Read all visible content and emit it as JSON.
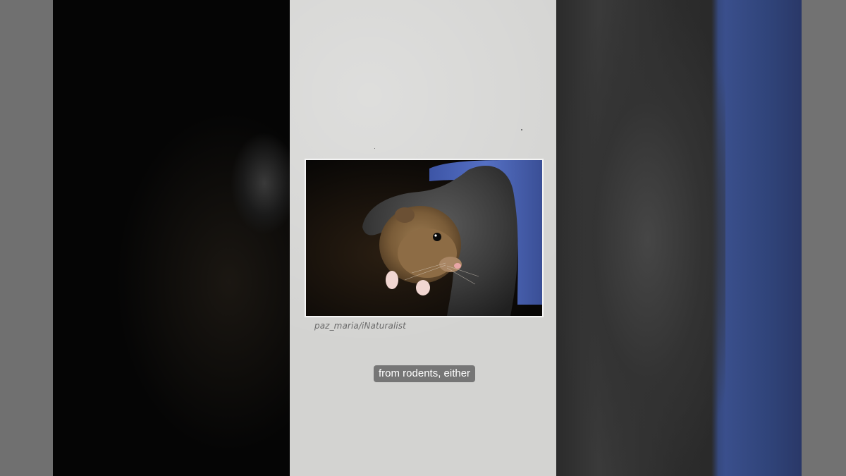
{
  "video": {
    "image_credit": "paz_maria/iNaturalist",
    "caption": "from rodents, either",
    "photo_subject": "mouse-on-glove-image"
  },
  "colors": {
    "paper": "#d3d3d1",
    "caption_bg": "#6e6e6e",
    "caption_text": "#ffffff",
    "credit_text": "#6a6a6a",
    "glove_blue": "#4a62b0"
  }
}
